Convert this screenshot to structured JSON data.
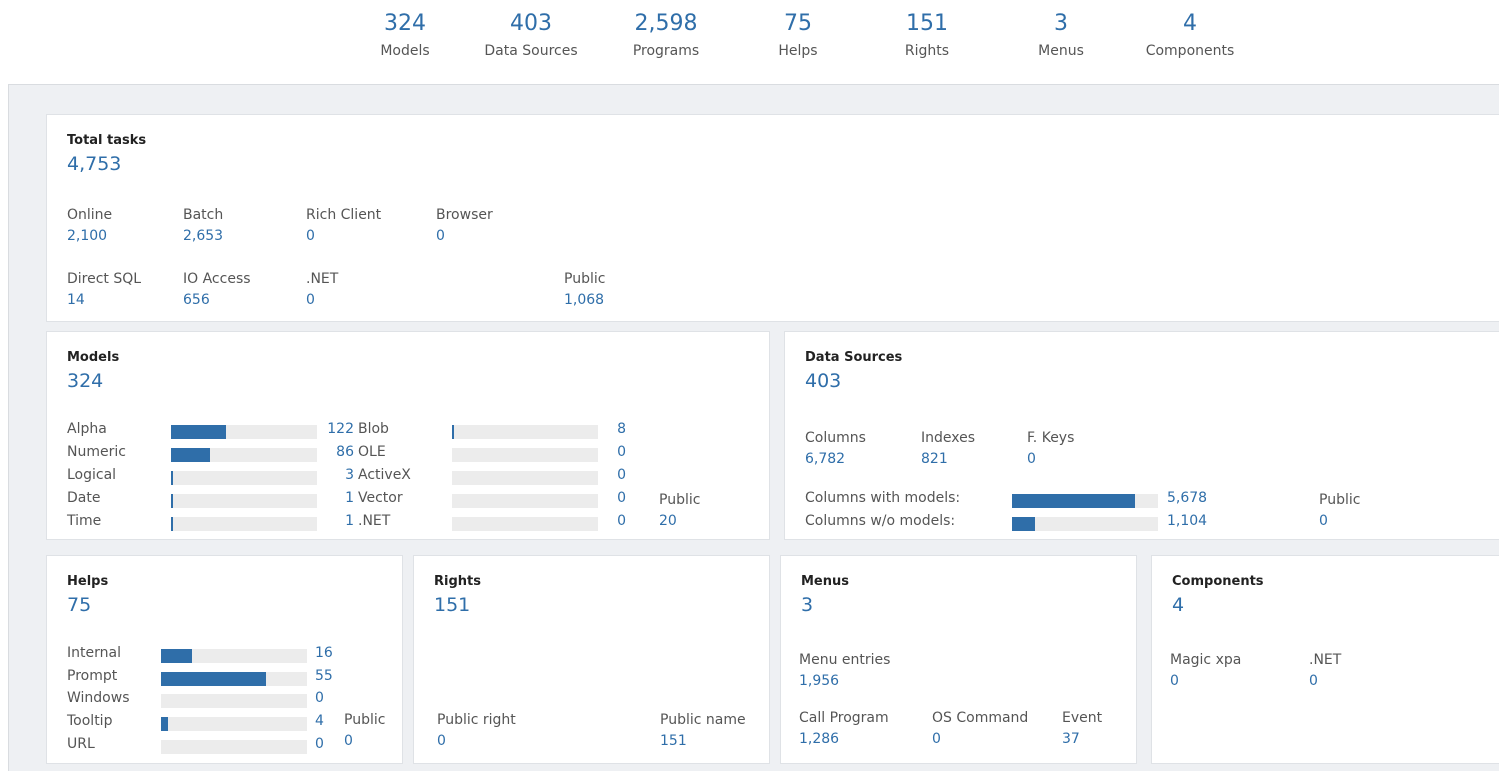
{
  "summary": [
    {
      "num": "324",
      "label": "Models"
    },
    {
      "num": "403",
      "label": "Data Sources"
    },
    {
      "num": "2,598",
      "label": "Programs"
    },
    {
      "num": "75",
      "label": "Helps"
    },
    {
      "num": "151",
      "label": "Rights"
    },
    {
      "num": "3",
      "label": "Menus"
    },
    {
      "num": "4",
      "label": "Components"
    }
  ],
  "tasks": {
    "title": "Total tasks",
    "total": "4,753",
    "stats": [
      {
        "label": "Online",
        "value": "2,100"
      },
      {
        "label": "Batch",
        "value": "2,653"
      },
      {
        "label": "Rich Client",
        "value": "0"
      },
      {
        "label": "Browser",
        "value": "0"
      },
      {
        "label": "Direct SQL",
        "value": "14"
      },
      {
        "label": "IO Access",
        "value": "656"
      },
      {
        "label": ".NET",
        "value": "0"
      },
      {
        "label": "Public",
        "value": "1,068"
      }
    ]
  },
  "models": {
    "title": "Models",
    "total": "324",
    "left": [
      {
        "label": "Alpha",
        "value": "122",
        "fraction": 0.38
      },
      {
        "label": "Numeric",
        "value": "86",
        "fraction": 0.27
      },
      {
        "label": "Logical",
        "value": "3",
        "fraction": 0.01
      },
      {
        "label": "Date",
        "value": "1",
        "fraction": 0.01
      },
      {
        "label": "Time",
        "value": "1",
        "fraction": 0.01
      }
    ],
    "right": [
      {
        "label": "Blob",
        "value": "8",
        "fraction": 0.015
      },
      {
        "label": "OLE",
        "value": "0",
        "fraction": 0
      },
      {
        "label": "ActiveX",
        "value": "0",
        "fraction": 0
      },
      {
        "label": "Vector",
        "value": "0",
        "fraction": 0
      },
      {
        "label": ".NET",
        "value": "0",
        "fraction": 0
      }
    ],
    "public_label": "Public",
    "public_value": "20"
  },
  "datasources": {
    "title": "Data Sources",
    "total": "403",
    "stats": [
      {
        "label": "Columns",
        "value": "6,782"
      },
      {
        "label": "Indexes",
        "value": "821"
      },
      {
        "label": "F. Keys",
        "value": "0"
      }
    ],
    "bars": [
      {
        "label": "Columns with models:",
        "value": "5,678",
        "fraction": 0.84
      },
      {
        "label": "Columns w/o models:",
        "value": "1,104",
        "fraction": 0.16
      }
    ],
    "public_label": "Public",
    "public_value": "0"
  },
  "helps": {
    "title": "Helps",
    "total": "75",
    "bars": [
      {
        "label": "Internal",
        "value": "16",
        "fraction": 0.21
      },
      {
        "label": "Prompt",
        "value": "55",
        "fraction": 0.72
      },
      {
        "label": "Windows",
        "value": "0",
        "fraction": 0
      },
      {
        "label": "Tooltip",
        "value": "4",
        "fraction": 0.05
      },
      {
        "label": "URL",
        "value": "0",
        "fraction": 0
      }
    ],
    "public_label": "Public",
    "public_value": "0"
  },
  "rights": {
    "title": "Rights",
    "total": "151",
    "stats": [
      {
        "label": "Public right",
        "value": "0"
      },
      {
        "label": "Public name",
        "value": "151"
      }
    ]
  },
  "menus": {
    "title": "Menus",
    "total": "3",
    "stats": [
      {
        "label": "Menu entries",
        "value": "1,956"
      },
      {
        "label": "Call Program",
        "value": "1,286"
      },
      {
        "label": "OS Command",
        "value": "0"
      },
      {
        "label": "Event",
        "value": "37"
      }
    ]
  },
  "components": {
    "title": "Components",
    "total": "4",
    "stats": [
      {
        "label": "Magic xpa",
        "value": "0"
      },
      {
        "label": ".NET",
        "value": "0"
      }
    ]
  },
  "colors": {
    "accent": "#2f6ea9",
    "track": "#ececec",
    "background": "#eef0f3"
  }
}
